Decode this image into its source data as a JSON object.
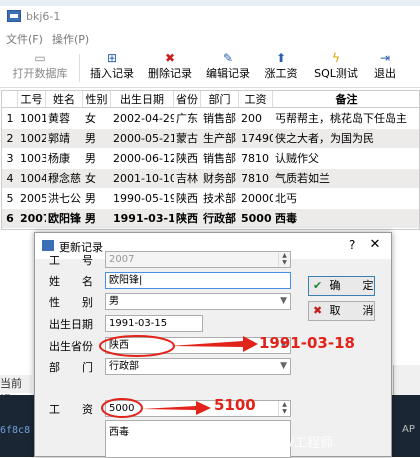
{
  "window": {
    "title": "bkj6-1"
  },
  "menubar": {
    "items": [
      "文件(F)",
      "操作(P)"
    ]
  },
  "toolbar": {
    "buttons": [
      {
        "label": "打开数据库",
        "icon": "folder-icon",
        "glyph": "▭"
      },
      {
        "label": "插入记录",
        "icon": "insert-icon",
        "glyph": "⊞"
      },
      {
        "label": "删除记录",
        "icon": "delete-icon",
        "glyph": "✖"
      },
      {
        "label": "编辑记录",
        "icon": "edit-icon",
        "glyph": "✎"
      },
      {
        "label": "涨工资",
        "icon": "arrow-up-icon",
        "glyph": "⬆"
      },
      {
        "label": "SQL测试",
        "icon": "lightning-icon",
        "glyph": "ϟ"
      },
      {
        "label": "退出",
        "icon": "exit-icon",
        "glyph": "⇥"
      }
    ]
  },
  "table": {
    "headers": [
      "工号",
      "姓名",
      "性别",
      "出生日期",
      "省份",
      "部门",
      "工资",
      "备注"
    ],
    "rows": [
      {
        "num": "1",
        "cells": [
          "1001",
          "黄蓉",
          "女",
          "2002-04-29",
          "广东",
          "销售部",
          "200",
          "丐帮帮主，桃花岛下任岛主"
        ]
      },
      {
        "num": "2",
        "cells": [
          "1002",
          "郭靖",
          "男",
          "2000-05-21",
          "蒙古",
          "生产部",
          "17490",
          "侠之大者，为国为民"
        ]
      },
      {
        "num": "3",
        "cells": [
          "1003",
          "杨康",
          "男",
          "2000-06-12",
          "陕西",
          "销售部",
          "7810",
          "认贼作父"
        ]
      },
      {
        "num": "4",
        "cells": [
          "1004",
          "穆念慈",
          "女",
          "2001-10-10",
          "吉林",
          "财务部",
          "7810",
          "气质若如兰"
        ]
      },
      {
        "num": "5",
        "cells": [
          "2005",
          "洪七公",
          "男",
          "1990-05-19",
          "陕西",
          "技术部",
          "20000",
          "北丐"
        ]
      },
      {
        "num": "6",
        "cells": [
          "2007",
          "欧阳锋",
          "男",
          "1991-03-15",
          "陕西",
          "行政部",
          "5000",
          "西毒"
        ]
      }
    ]
  },
  "status": {
    "text": "当前记"
  },
  "terminal": {
    "left_text": "6f8c8",
    "right_text": "AP"
  },
  "dialog": {
    "title": "更新记录",
    "help": "?",
    "close": "✕",
    "fields": {
      "id_label": "工　　号",
      "id_value": "2007",
      "name_label": "姓　　名",
      "name_value": "欧阳锋|",
      "gender_label": "性　　别",
      "gender_value": "男",
      "birth_label": "出生日期",
      "birth_value": "1991-03-15",
      "province_label": "出生省份",
      "province_value": "陕西",
      "dept_label": "部　　门",
      "dept_value": "行政部",
      "salary_label": "工　　资",
      "salary_value": "5000",
      "memo_value": "西毒"
    },
    "ok_label": "确　　定",
    "cancel_label": "取　　消"
  },
  "annotations": {
    "birth_new": "1991-03-18",
    "salary_new": "5100",
    "color": "#e2231a"
  },
  "watermark": "CSDN @会洗碗的CV工程师"
}
